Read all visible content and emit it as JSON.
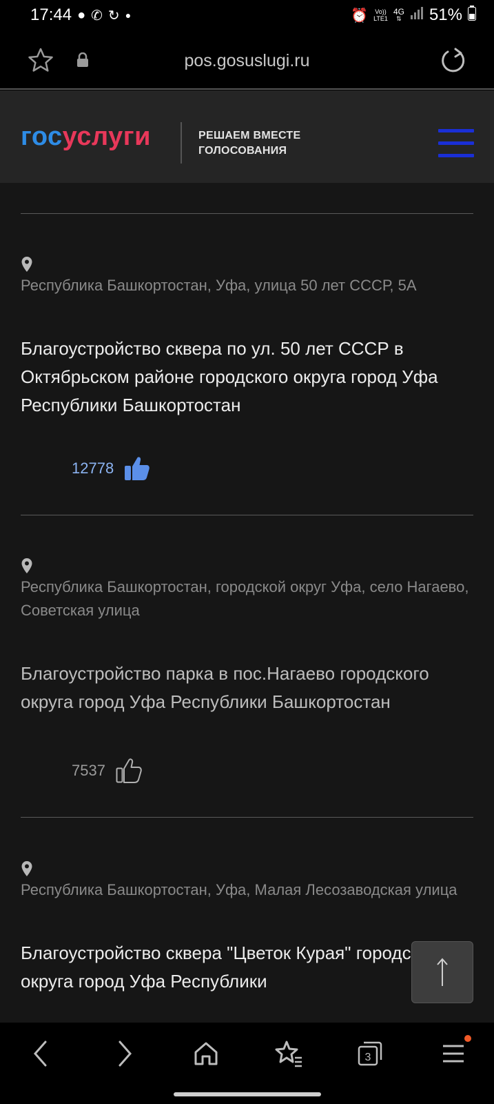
{
  "status_bar": {
    "time": "17:44",
    "network_top": "Vo))",
    "network_bottom": "LTE1",
    "data_type": "4G",
    "battery": "51%"
  },
  "browser": {
    "url": "pos.gosuslugi.ru"
  },
  "header": {
    "logo_part1": "гос",
    "logo_part2": "услуги",
    "subtitle_line1": "РЕШАЕМ ВМЕСТЕ",
    "subtitle_line2": "ГОЛОСОВАНИЯ",
    "colors": {
      "logo_blue": "#2e8ce6",
      "logo_red": "#e8385a",
      "menu": "#1a2fd6"
    }
  },
  "projects": [
    {
      "address": "Республика Башкортостан, Уфа, улица 50 лет СССР, 5А",
      "title": "Благоустройство сквера по ул. 50 лет СССР в Октябрьском районе городского округа город Уфа Республики Башкортостан",
      "votes": "12778",
      "liked": true
    },
    {
      "address": "Республика Башкортостан, городской округ Уфа, село Нагаево, Советская улица",
      "title": "Благоустройство парка в пос.Нагаево городского округа город Уфа Республики Башкортостан",
      "votes": "7537",
      "liked": false
    },
    {
      "address": "Республика Башкортостан, Уфа, Малая Лесозаводская улица",
      "title": "Благоустройство сквера \"Цветок Курая\" городского округа город Уфа Республики",
      "votes": "",
      "liked": false
    }
  ],
  "scroll_top_icon": "arrow-up-icon",
  "bottom_nav": {
    "tabs_count": "3",
    "icons": [
      "back-icon",
      "forward-icon",
      "home-icon",
      "bookmarks-icon",
      "tabs-icon",
      "menu-icon"
    ]
  }
}
